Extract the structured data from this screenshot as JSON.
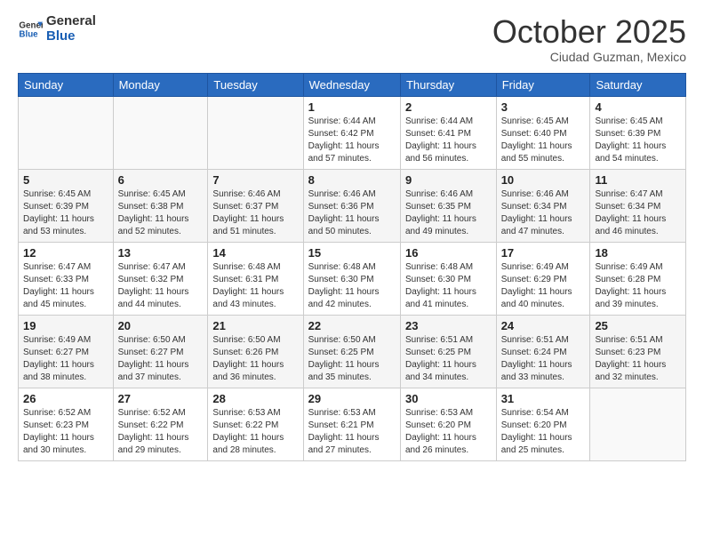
{
  "header": {
    "logo_line1": "General",
    "logo_line2": "Blue",
    "month": "October 2025",
    "location": "Ciudad Guzman, Mexico"
  },
  "weekdays": [
    "Sunday",
    "Monday",
    "Tuesday",
    "Wednesday",
    "Thursday",
    "Friday",
    "Saturday"
  ],
  "weeks": [
    [
      {
        "day": "",
        "info": ""
      },
      {
        "day": "",
        "info": ""
      },
      {
        "day": "",
        "info": ""
      },
      {
        "day": "1",
        "info": "Sunrise: 6:44 AM\nSunset: 6:42 PM\nDaylight: 11 hours and 57 minutes."
      },
      {
        "day": "2",
        "info": "Sunrise: 6:44 AM\nSunset: 6:41 PM\nDaylight: 11 hours and 56 minutes."
      },
      {
        "day": "3",
        "info": "Sunrise: 6:45 AM\nSunset: 6:40 PM\nDaylight: 11 hours and 55 minutes."
      },
      {
        "day": "4",
        "info": "Sunrise: 6:45 AM\nSunset: 6:39 PM\nDaylight: 11 hours and 54 minutes."
      }
    ],
    [
      {
        "day": "5",
        "info": "Sunrise: 6:45 AM\nSunset: 6:39 PM\nDaylight: 11 hours and 53 minutes."
      },
      {
        "day": "6",
        "info": "Sunrise: 6:45 AM\nSunset: 6:38 PM\nDaylight: 11 hours and 52 minutes."
      },
      {
        "day": "7",
        "info": "Sunrise: 6:46 AM\nSunset: 6:37 PM\nDaylight: 11 hours and 51 minutes."
      },
      {
        "day": "8",
        "info": "Sunrise: 6:46 AM\nSunset: 6:36 PM\nDaylight: 11 hours and 50 minutes."
      },
      {
        "day": "9",
        "info": "Sunrise: 6:46 AM\nSunset: 6:35 PM\nDaylight: 11 hours and 49 minutes."
      },
      {
        "day": "10",
        "info": "Sunrise: 6:46 AM\nSunset: 6:34 PM\nDaylight: 11 hours and 47 minutes."
      },
      {
        "day": "11",
        "info": "Sunrise: 6:47 AM\nSunset: 6:34 PM\nDaylight: 11 hours and 46 minutes."
      }
    ],
    [
      {
        "day": "12",
        "info": "Sunrise: 6:47 AM\nSunset: 6:33 PM\nDaylight: 11 hours and 45 minutes."
      },
      {
        "day": "13",
        "info": "Sunrise: 6:47 AM\nSunset: 6:32 PM\nDaylight: 11 hours and 44 minutes."
      },
      {
        "day": "14",
        "info": "Sunrise: 6:48 AM\nSunset: 6:31 PM\nDaylight: 11 hours and 43 minutes."
      },
      {
        "day": "15",
        "info": "Sunrise: 6:48 AM\nSunset: 6:30 PM\nDaylight: 11 hours and 42 minutes."
      },
      {
        "day": "16",
        "info": "Sunrise: 6:48 AM\nSunset: 6:30 PM\nDaylight: 11 hours and 41 minutes."
      },
      {
        "day": "17",
        "info": "Sunrise: 6:49 AM\nSunset: 6:29 PM\nDaylight: 11 hours and 40 minutes."
      },
      {
        "day": "18",
        "info": "Sunrise: 6:49 AM\nSunset: 6:28 PM\nDaylight: 11 hours and 39 minutes."
      }
    ],
    [
      {
        "day": "19",
        "info": "Sunrise: 6:49 AM\nSunset: 6:27 PM\nDaylight: 11 hours and 38 minutes."
      },
      {
        "day": "20",
        "info": "Sunrise: 6:50 AM\nSunset: 6:27 PM\nDaylight: 11 hours and 37 minutes."
      },
      {
        "day": "21",
        "info": "Sunrise: 6:50 AM\nSunset: 6:26 PM\nDaylight: 11 hours and 36 minutes."
      },
      {
        "day": "22",
        "info": "Sunrise: 6:50 AM\nSunset: 6:25 PM\nDaylight: 11 hours and 35 minutes."
      },
      {
        "day": "23",
        "info": "Sunrise: 6:51 AM\nSunset: 6:25 PM\nDaylight: 11 hours and 34 minutes."
      },
      {
        "day": "24",
        "info": "Sunrise: 6:51 AM\nSunset: 6:24 PM\nDaylight: 11 hours and 33 minutes."
      },
      {
        "day": "25",
        "info": "Sunrise: 6:51 AM\nSunset: 6:23 PM\nDaylight: 11 hours and 32 minutes."
      }
    ],
    [
      {
        "day": "26",
        "info": "Sunrise: 6:52 AM\nSunset: 6:23 PM\nDaylight: 11 hours and 30 minutes."
      },
      {
        "day": "27",
        "info": "Sunrise: 6:52 AM\nSunset: 6:22 PM\nDaylight: 11 hours and 29 minutes."
      },
      {
        "day": "28",
        "info": "Sunrise: 6:53 AM\nSunset: 6:22 PM\nDaylight: 11 hours and 28 minutes."
      },
      {
        "day": "29",
        "info": "Sunrise: 6:53 AM\nSunset: 6:21 PM\nDaylight: 11 hours and 27 minutes."
      },
      {
        "day": "30",
        "info": "Sunrise: 6:53 AM\nSunset: 6:20 PM\nDaylight: 11 hours and 26 minutes."
      },
      {
        "day": "31",
        "info": "Sunrise: 6:54 AM\nSunset: 6:20 PM\nDaylight: 11 hours and 25 minutes."
      },
      {
        "day": "",
        "info": ""
      }
    ]
  ]
}
